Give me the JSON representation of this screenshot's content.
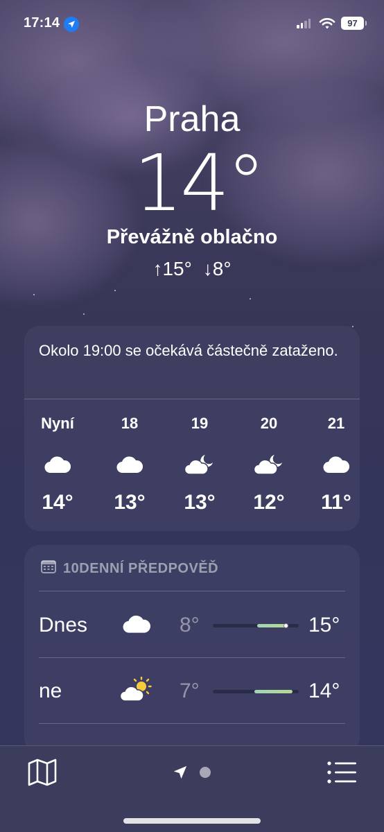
{
  "status_bar": {
    "time": "17:14",
    "battery": "97",
    "icons": [
      "location-arrow-icon",
      "cellular-signal-icon",
      "wifi-icon",
      "battery-icon"
    ]
  },
  "hero": {
    "city": "Praha",
    "temperature": "14°",
    "condition": "Převážně oblačno",
    "high": "↑15°",
    "low": "↓8°"
  },
  "hourly": {
    "summary": "Okolo 19:00 se očekává částečně zataženo.",
    "hours": [
      {
        "label": "Nyní",
        "icon": "cloud-icon",
        "temp": "14°"
      },
      {
        "label": "18",
        "icon": "cloud-icon",
        "temp": "13°"
      },
      {
        "label": "19",
        "icon": "moon-cloud-icon",
        "temp": "13°"
      },
      {
        "label": "20",
        "icon": "moon-cloud-icon",
        "temp": "12°"
      },
      {
        "label": "21",
        "icon": "cloud-icon",
        "temp": "11°"
      }
    ]
  },
  "daily": {
    "header": "10DENNÍ PŘEDPOVĚĎ",
    "header_icon": "calendar-icon",
    "days": [
      {
        "name": "Dnes",
        "icon": "cloud-icon",
        "low": "8°",
        "high": "15°",
        "range_start": 0.52,
        "range_end": 0.88,
        "current": 0.85
      },
      {
        "name": "ne",
        "icon": "sun-cloud-icon",
        "low": "7°",
        "high": "14°",
        "range_start": 0.48,
        "range_end": 0.93
      }
    ]
  },
  "toolbar": {
    "icons": [
      "map-icon",
      "location-arrow-icon",
      "page-dot-icon",
      "list-icon"
    ]
  },
  "colors": {
    "background": "#3a3a5c",
    "card": "#46466a",
    "location_badge": "#1f7cf5",
    "temp_bar": "#9fd5b8"
  }
}
